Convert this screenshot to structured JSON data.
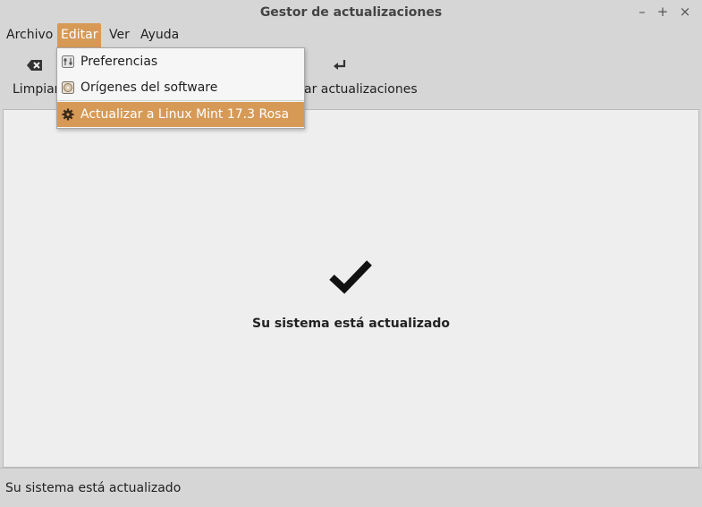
{
  "window": {
    "title": "Gestor de actualizaciones",
    "controls": {
      "minimize": "–",
      "maximize": "+",
      "close": "×"
    }
  },
  "menubar": {
    "items": [
      {
        "label": "Archivo"
      },
      {
        "label": "Editar"
      },
      {
        "label": "Ver"
      },
      {
        "label": "Ayuda"
      }
    ]
  },
  "toolbar": {
    "clear_label": "Limpiar",
    "install_label": "ar actualizaciones"
  },
  "edit_menu": {
    "items": [
      {
        "label": "Preferencias",
        "icon": "preferences-icon"
      },
      {
        "label": "Orígenes del software",
        "icon": "software-sources-icon"
      },
      {
        "label": "Actualizar a Linux Mint 17.3 Rosa",
        "icon": "upgrade-gear-icon"
      }
    ]
  },
  "main": {
    "status_icon": "checkmark-icon",
    "message": "Su sistema está actualizado"
  },
  "statusbar": {
    "text": "Su sistema está actualizado"
  },
  "colors": {
    "accent": "#d69a56",
    "window_bg": "#d6d6d6",
    "content_bg": "#eeeeee"
  }
}
